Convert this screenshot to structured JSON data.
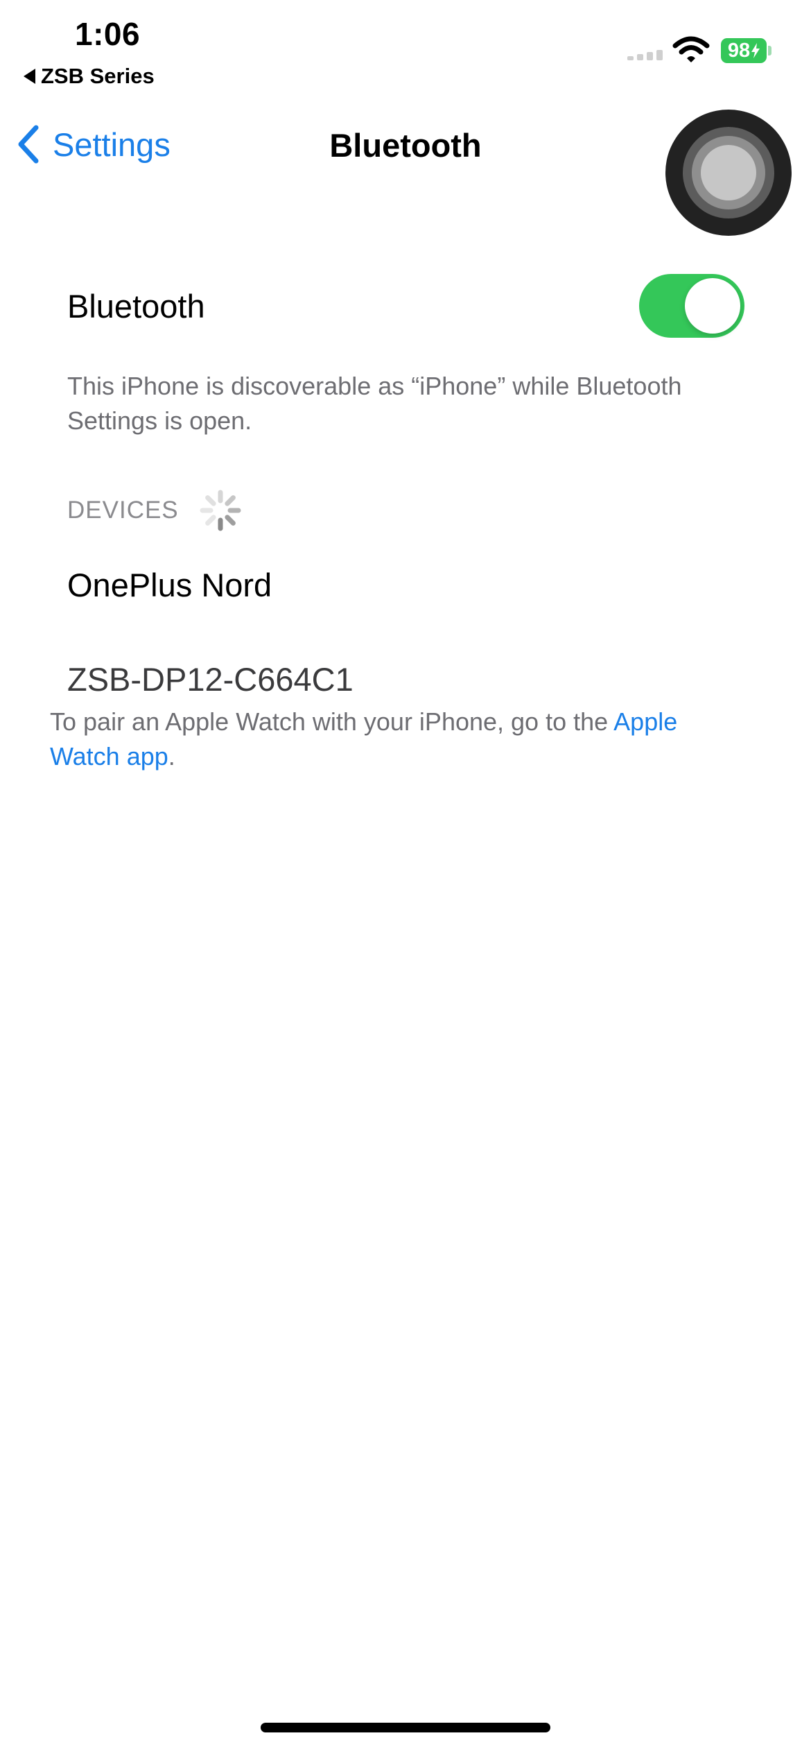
{
  "status_bar": {
    "time": "1:06",
    "back_app_label": "ZSB Series",
    "battery_level": "98",
    "battery_color": "#34c759"
  },
  "nav": {
    "back_label": "Settings",
    "title": "Bluetooth"
  },
  "bluetooth": {
    "label": "Bluetooth",
    "enabled": true,
    "discoverable_text": "This iPhone is discoverable as “iPhone” while Bluetooth Settings is open."
  },
  "devices": {
    "header": "DEVICES",
    "items": [
      {
        "name": "OnePlus Nord"
      },
      {
        "name": "ZSB-DP12-C664C1"
      }
    ]
  },
  "watch_note": {
    "text": "To pair an Apple Watch with your iPhone, go to the ",
    "link": "Apple Watch app",
    "suffix": "."
  },
  "icons": {
    "nav_back": "chevron-left-icon",
    "status_back": "back-triangle-icon",
    "wifi": "wifi-icon",
    "spinner": "activity-spinner-icon",
    "assistive_touch": "assistive-touch-icon"
  },
  "colors": {
    "accent": "#1a7fe8",
    "toggle_on": "#34c759",
    "secondary_text": "#6d6d72"
  }
}
